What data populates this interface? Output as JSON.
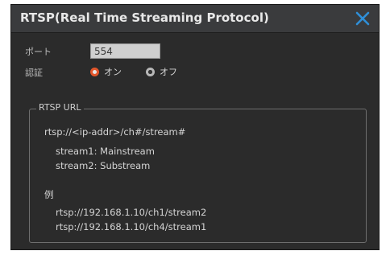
{
  "dialog": {
    "title": "RTSP(Real Time Streaming Protocol)",
    "close_icon": "close-icon",
    "accent_color": "#2f8fd8"
  },
  "settings": {
    "port_label": "ポート",
    "port_value": "554",
    "auth_label": "認証",
    "auth_options": [
      {
        "label": "オン",
        "selected": true
      },
      {
        "label": "オフ",
        "selected": false
      }
    ],
    "selected_color": "#e3572c"
  },
  "rtsp_url": {
    "legend": "RTSP URL",
    "format": "rtsp://<ip-addr>/ch#/stream#",
    "streams": [
      "stream1: Mainstream",
      "stream2: Substream"
    ],
    "example_label": "例",
    "examples": [
      "rtsp://192.168.1.10/ch1/stream2",
      "rtsp://192.168.1.10/ch4/stream1"
    ]
  }
}
